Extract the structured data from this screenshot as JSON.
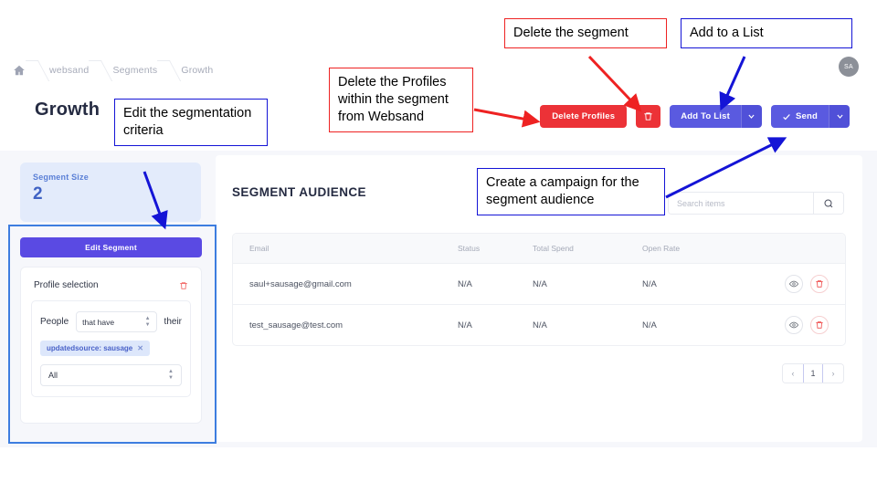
{
  "breadcrumb": {
    "home_icon": "home-icon",
    "items": [
      {
        "label": "websand"
      },
      {
        "label": "Segments"
      },
      {
        "label": "Growth"
      }
    ]
  },
  "header": {
    "title": "Growth",
    "avatar_initials": "SA",
    "actions": {
      "delete_profiles_label": "Delete Profiles",
      "delete_segment_icon": "trash-icon",
      "add_to_list_label": "Add To List",
      "add_to_list_caret_icon": "chevron-down-icon",
      "send_label": "Send",
      "send_check_icon": "check-icon",
      "send_caret_icon": "chevron-down-icon"
    }
  },
  "sidebar": {
    "segment_size_label": "Segment Size",
    "segment_size_value": "2",
    "edit_segment_label": "Edit Segment",
    "profile_selection": {
      "title": "Profile selection",
      "delete_icon": "trash-icon",
      "people_label": "People",
      "condition_value": "that have",
      "their_label": "their",
      "chip_label": "updatedsource: sausage",
      "chip_remove_icon": "close-icon",
      "scope_value": "All"
    }
  },
  "main": {
    "title": "SEGMENT AUDIENCE",
    "search": {
      "placeholder": "Search items",
      "value": "",
      "icon": "search-icon"
    },
    "table": {
      "columns": [
        "Email",
        "Status",
        "Total Spend",
        "Open Rate"
      ],
      "rows": [
        {
          "email": "saul+sausage@gmail.com",
          "status": "N/A",
          "total_spend": "N/A",
          "open_rate": "N/A",
          "view_icon": "eye-icon",
          "delete_icon": "trash-icon"
        },
        {
          "email": "test_sausage@test.com",
          "status": "N/A",
          "total_spend": "N/A",
          "open_rate": "N/A",
          "view_icon": "eye-icon",
          "delete_icon": "trash-icon"
        }
      ]
    },
    "pagination": {
      "prev_label": "‹",
      "current_page": "1",
      "next_label": "›"
    }
  },
  "annotations": [
    {
      "id": "anno-delete-profiles",
      "text": "Delete the Profiles within the segment from Websand",
      "color": "#ee2222"
    },
    {
      "id": "anno-delete-segment",
      "text": "Delete the segment",
      "color": "#ee2222"
    },
    {
      "id": "anno-add-to-list",
      "text": "Add to a List",
      "color": "#1414d6"
    },
    {
      "id": "anno-edit-criteria",
      "text": "Edit the segmentation criteria",
      "color": "#1414d6"
    },
    {
      "id": "anno-create-campaign",
      "text": "Create a campaign for the segment audience",
      "color": "#1414d6"
    }
  ],
  "colors": {
    "primary": "#5a4ae3",
    "danger": "#ec3237",
    "page_bg": "#f6f7fb",
    "annotation_red": "#ee2222",
    "annotation_blue": "#1414d6",
    "highlight_blue": "#3d7de0"
  }
}
